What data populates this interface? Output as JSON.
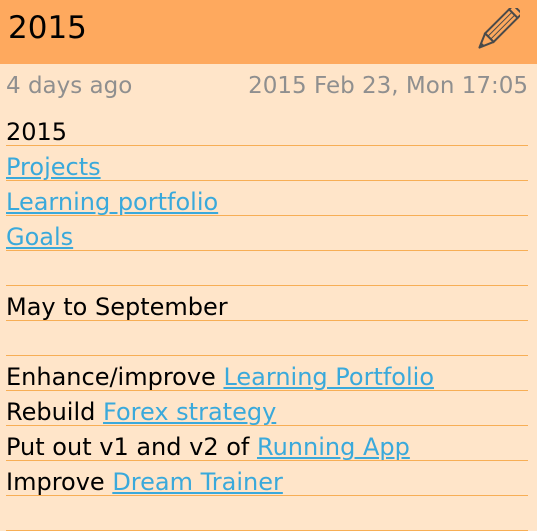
{
  "header": {
    "title": "2015",
    "edit_icon": "pencil-icon"
  },
  "meta": {
    "relative_time": "4 days ago",
    "timestamp": "2015 Feb 23, Mon 17:05"
  },
  "note": {
    "lines": [
      {
        "text": "2015"
      },
      {
        "link": "Projects"
      },
      {
        "link": "Learning portfolio"
      },
      {
        "link": "Goals"
      },
      {
        "text": ""
      },
      {
        "text": "May to September"
      },
      {
        "text": ""
      },
      {
        "text": "Enhance/improve ",
        "link": "Learning Portfolio"
      },
      {
        "text": "Rebuild ",
        "link": "Forex strategy"
      },
      {
        "text": "Put out v1 and v2 of ",
        "link": "Running App"
      },
      {
        "text": "Improve ",
        "link": "Dream Trainer"
      },
      {
        "text": ""
      }
    ]
  },
  "colors": {
    "header_bg": "#FEA95E",
    "page_bg": "#FFE5C9",
    "link": "#3AA9DB",
    "rule": "#F7AE55",
    "meta_text": "#8F8F8F"
  }
}
